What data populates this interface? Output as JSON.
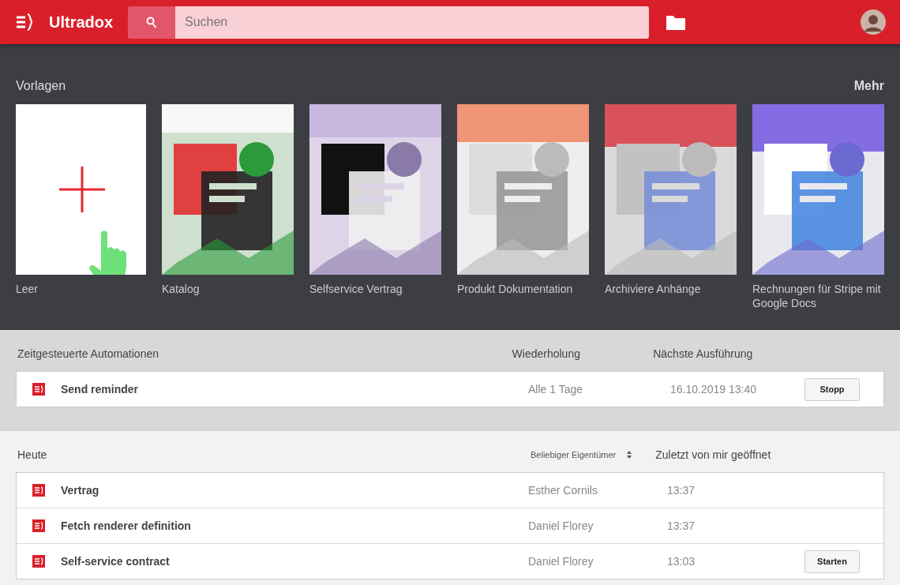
{
  "header": {
    "app_name": "Ultradox",
    "search": {
      "placeholder": "Suchen"
    }
  },
  "templates": {
    "title": "Vorlagen",
    "more": "Mehr",
    "items": [
      {
        "kind": "blank",
        "label": "Leer"
      },
      {
        "kind": "picture",
        "label": "Katalog"
      },
      {
        "kind": "picture",
        "label": "Selfservice Vertrag"
      },
      {
        "kind": "picture",
        "label": "Produkt Dokumentation"
      },
      {
        "kind": "picture",
        "label": "Archiviere Anhänge"
      },
      {
        "kind": "picture",
        "label": "Rechnungen für Stripe mit Google Docs"
      }
    ]
  },
  "scheduled": {
    "columns": [
      "Zeitgesteuerte Automationen",
      "Wiederholung",
      "Nächste Ausführung"
    ],
    "rows": [
      {
        "name": "Send reminder",
        "repeat": "Alle 1 Tage",
        "next": "16.10.2019 13:40",
        "action": "Stopp"
      }
    ]
  },
  "recent": {
    "title": "Heute",
    "owner_filter": "Beliebiger Eigentümer",
    "opened_column": "Zuletzt von mir geöffnet",
    "rows": [
      {
        "name": "Vertrag",
        "owner": "Esther Cornils",
        "time": "13:37"
      },
      {
        "name": "Fetch renderer definition",
        "owner": "Daniel Florey",
        "time": "13:37"
      },
      {
        "name": "Self-service contract",
        "owner": "Daniel Florey",
        "time": "13:03",
        "action": "Starten"
      }
    ]
  }
}
